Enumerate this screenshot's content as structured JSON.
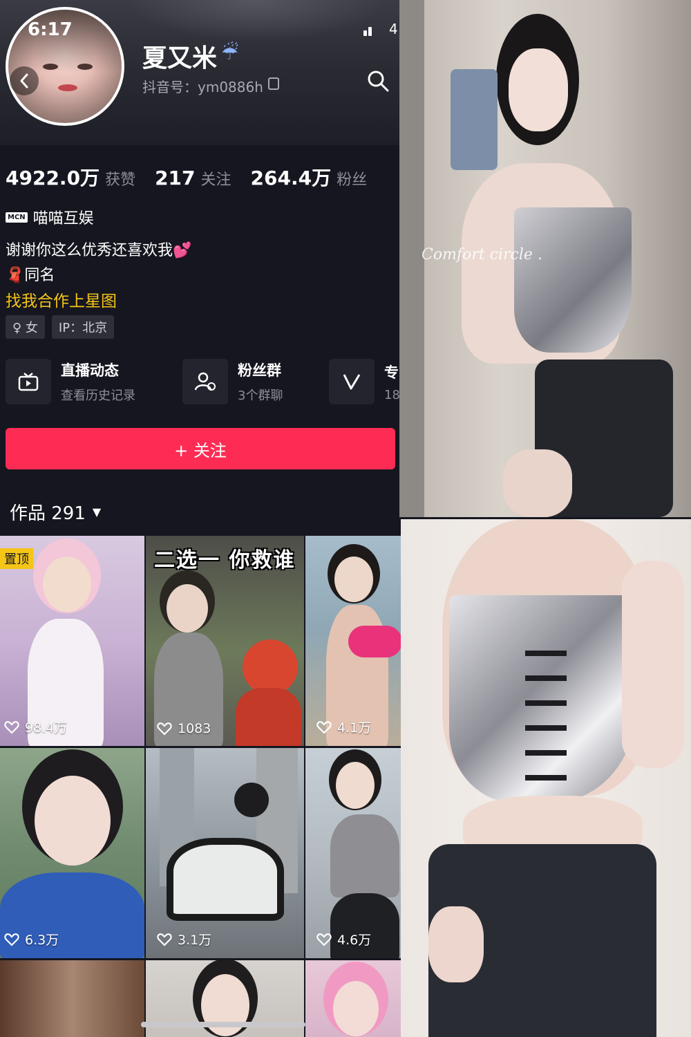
{
  "status_bar": {
    "time": "6:17",
    "battery": "4"
  },
  "profile": {
    "nickname": "夏又米",
    "nickname_emoji": "☔",
    "douyin_id": "抖音号：ym0886h",
    "stats": [
      {
        "value": "4922.0万",
        "label": "获赞"
      },
      {
        "value": "217",
        "label": "关注"
      },
      {
        "value": "264.4万",
        "label": "粉丝"
      }
    ],
    "mcn_badge": "MCN",
    "mcn_name": "喵喵互娱",
    "bio_line_1": "谢谢你这么优秀还喜欢我💕",
    "bio_line_2": "🧣同名",
    "bio_link": "找我合作上星图",
    "tags": [
      "♀ 女",
      "IP：北京"
    ]
  },
  "entries": [
    {
      "title": "直播动态",
      "subtitle": "查看历史记录",
      "icon": "tv-icon"
    },
    {
      "title": "粉丝群",
      "subtitle": "3个群聊",
      "icon": "people-icon"
    },
    {
      "title": "专",
      "subtitle": "18",
      "icon": "v-icon"
    }
  ],
  "follow_button": "+ 关注",
  "works_tab": {
    "label": "作品 291",
    "caret": "▼"
  },
  "grid": {
    "pin_badge": "置顶",
    "cell_2_overlay": "二选一 你救谁",
    "likes": [
      "98.4万",
      "1083",
      "4.1万",
      "6.3万",
      "3.1万",
      "4.6万"
    ]
  },
  "photo_watermark": "Comfort circle .",
  "colors": {
    "accent": "#fe2c55",
    "link": "#f5c518",
    "background": "#15161f"
  }
}
